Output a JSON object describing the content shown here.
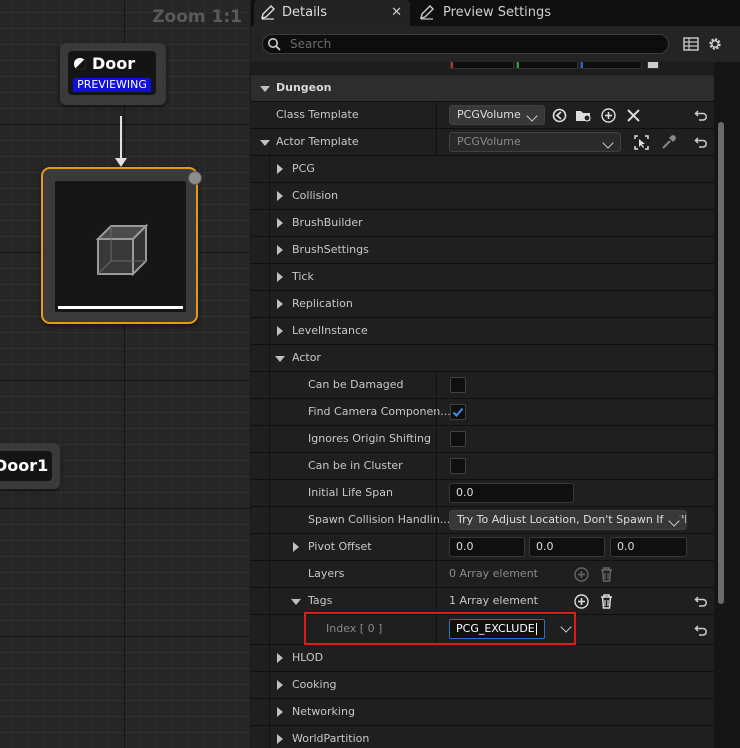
{
  "graph": {
    "zoom_label": "Zoom 1:1",
    "door_node": {
      "title": "Door",
      "badge": "PREVIEWING"
    },
    "door1_node": {
      "title": "Door1"
    }
  },
  "tabs": {
    "details": "Details",
    "close": "✕",
    "preview_settings": "Preview Settings"
  },
  "search": {
    "placeholder": "Search"
  },
  "sections": {
    "dungeon": "Dungeon",
    "class_template": {
      "label": "Class Template",
      "value": "PCGVolume"
    },
    "actor_template": {
      "label": "Actor Template",
      "value": "PCGVolume"
    },
    "collapsed_before": [
      "PCG",
      "Collision",
      "BrushBuilder",
      "BrushSettings",
      "Tick",
      "Replication",
      "LevelInstance"
    ],
    "actor": "Actor",
    "collapsed_after": [
      "HLOD",
      "Cooking",
      "Networking",
      "WorldPartition"
    ]
  },
  "actor_props": {
    "can_be_damaged": {
      "label": "Can be Damaged",
      "checked": false
    },
    "find_camera": {
      "label": "Find Camera Componen...",
      "checked": true
    },
    "ignores_origin": {
      "label": "Ignores Origin Shifting",
      "checked": false
    },
    "can_be_in_cluster": {
      "label": "Can be in Cluster",
      "checked": false
    },
    "initial_life_span": {
      "label": "Initial Life Span",
      "value": "0.0"
    },
    "spawn_collision": {
      "label": "Spawn Collision Handlin...",
      "value": "Try To Adjust Location, Don't Spawn If Still Colliding"
    },
    "pivot_offset": {
      "label": "Pivot Offset",
      "x": "0.0",
      "y": "0.0",
      "z": "0.0"
    },
    "layers": {
      "label": "Layers",
      "summary": "0 Array element"
    },
    "tags": {
      "label": "Tags",
      "summary": "1 Array element"
    },
    "tag_index": {
      "label": "Index [ 0 ]",
      "value": "PCG_EXCLUDE"
    }
  },
  "colors": {
    "selection_outline": "#e49a14",
    "highlight": "#e01a1a",
    "check": "#3a8ef0",
    "preview_badge": "#1010d8"
  }
}
